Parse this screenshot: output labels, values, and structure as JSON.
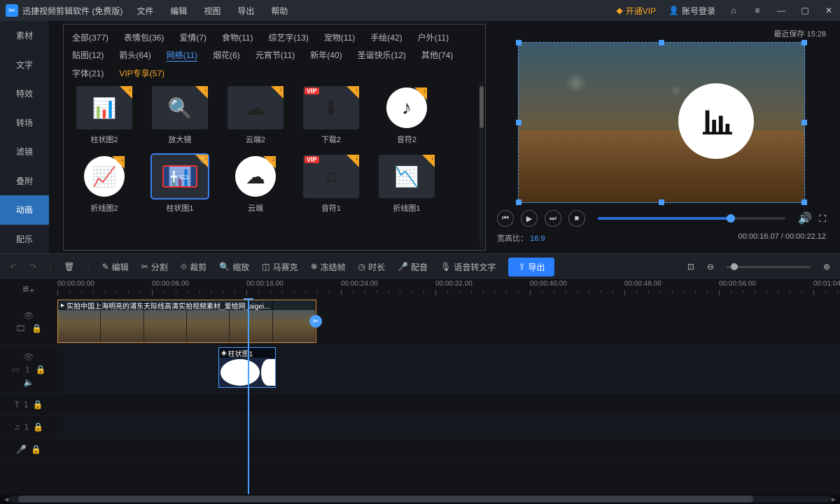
{
  "titlebar": {
    "app_name": "迅捷视频剪辑软件 (免费版)",
    "menus": [
      "文件",
      "编辑",
      "视图",
      "导出",
      "帮助"
    ],
    "vip": "开通VIP",
    "login": "账号登录"
  },
  "side_tabs": [
    "素材",
    "文字",
    "特效",
    "转场",
    "滤镜",
    "叠附",
    "动画",
    "配乐"
  ],
  "side_active": 6,
  "categories": [
    {
      "label": "全部(377)"
    },
    {
      "label": "表情包(36)"
    },
    {
      "label": "爱情(7)"
    },
    {
      "label": "食物(11)"
    },
    {
      "label": "综艺字(13)"
    },
    {
      "label": "宠物(11)"
    },
    {
      "label": "手绘(42)"
    },
    {
      "label": "户外(11)"
    },
    {
      "label": "贴图(12)"
    },
    {
      "label": "箭头(64)"
    },
    {
      "label": "网络(11)",
      "active": true
    },
    {
      "label": "烟花(6)"
    },
    {
      "label": "元宵节(11)"
    },
    {
      "label": "新年(40)"
    },
    {
      "label": "圣诞快乐(12)"
    },
    {
      "label": "其他(74)"
    },
    {
      "label": "字体(21)"
    },
    {
      "label": "VIP专享(57)",
      "vip": true
    }
  ],
  "assets": [
    {
      "label": "柱状图2"
    },
    {
      "label": "放大镜"
    },
    {
      "label": "云端2"
    },
    {
      "label": "下载2",
      "vip": true
    },
    {
      "label": "音符2"
    },
    {
      "label": "折线图2"
    },
    {
      "label": "柱状图1",
      "selected": true
    },
    {
      "label": "云端"
    },
    {
      "label": "音符1",
      "vip": true
    },
    {
      "label": "折线图1"
    }
  ],
  "preview": {
    "saved": "最近保存 15:28",
    "ratio_label": "宽高比：",
    "ratio_value": "16:9",
    "time_current": "00:00:16.07",
    "time_total": "00:00:22.12"
  },
  "toolbar": {
    "undo": "↶",
    "redo": "↷",
    "delete": "🗑",
    "edit": "编辑",
    "split": "分割",
    "crop": "裁剪",
    "zoom": "缩放",
    "mosaic": "马赛克",
    "freeze": "冻结帧",
    "duration": "时长",
    "dub": "配音",
    "speech": "语音转文字",
    "export": "导出"
  },
  "timeline": {
    "ticks": [
      "00:00:00.00",
      "00:00:08.00",
      "00:00:16.00",
      "00:00:24.00",
      "00:00:32.00",
      "00:00:40.00",
      "00:00:48.00",
      "00:00:56.00",
      "00:01:04"
    ],
    "clip_video": "实拍中国上海明亮的浦东天际线高清实拍视频素材_爱给网_aigei...",
    "clip_anim": "柱状图1"
  }
}
